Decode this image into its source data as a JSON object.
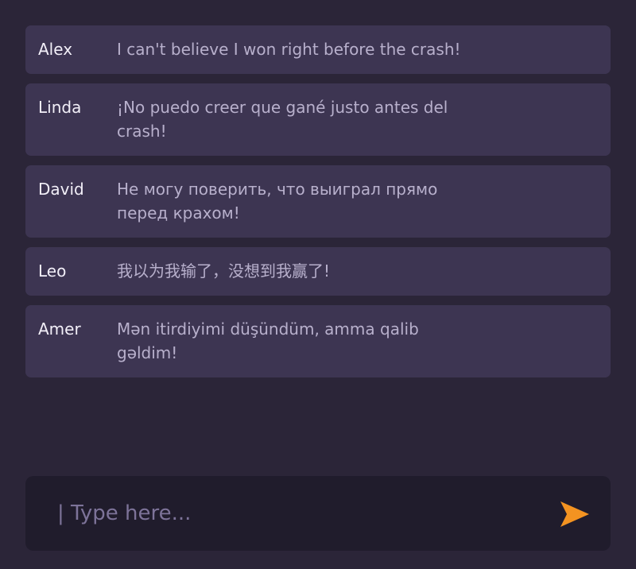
{
  "messages": [
    {
      "name": "Alex",
      "text": "I can't believe I won right before the crash!"
    },
    {
      "name": "Linda",
      "text": "¡No puedo creer que gané justo antes del crash!"
    },
    {
      "name": "David",
      "text": "Не могу поверить, что выиграл прямо перед крахом!"
    },
    {
      "name": "Leo",
      "text": "我以为我输了，没想到我赢了!"
    },
    {
      "name": "Amer",
      "text": "Mən itirdiyimi düşündüm, amma qalib gəldim!"
    }
  ],
  "composer": {
    "placeholder": "| Type here...",
    "send_icon": "send-arrow-icon",
    "accent_color": "#f39321"
  },
  "colors": {
    "background": "#2b2538",
    "message_bg": "#3d3552",
    "composer_bg": "#201c2c"
  }
}
